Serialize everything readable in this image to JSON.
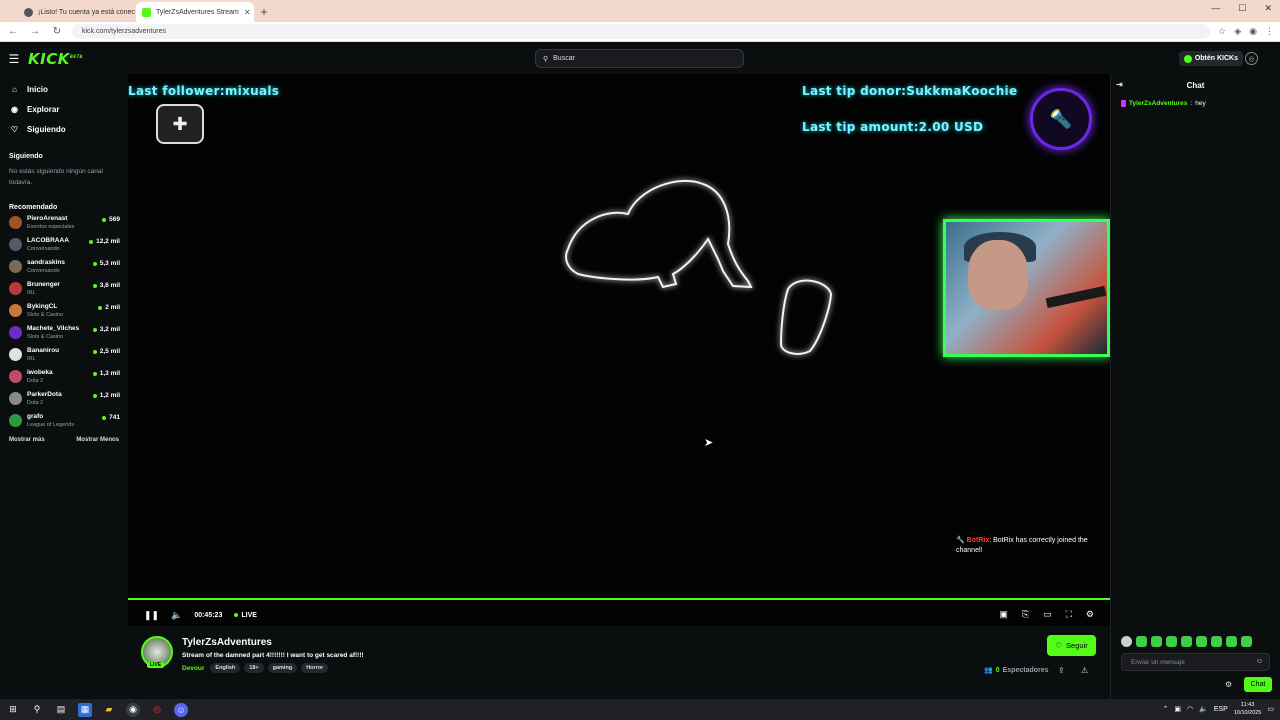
{
  "browser": {
    "tabs": [
      {
        "title": "¡Listo! Tu cuenta ya está conec",
        "icon": "search-icon"
      },
      {
        "title": "TylerZsAdventures Stream",
        "icon": "kick-icon"
      }
    ],
    "url": "kick.com/tylerzsadventures"
  },
  "topnav": {
    "logo": "KICK",
    "logo_badge": "BETA",
    "search_placeholder": "Buscar",
    "kicks_label": "Obtén KICKs"
  },
  "sidebar": {
    "links": [
      {
        "label": "Inicio",
        "icon": "home-icon"
      },
      {
        "label": "Explorar",
        "icon": "compass-icon"
      },
      {
        "label": "Siguiendo",
        "icon": "heart-icon"
      }
    ],
    "following_title": "Siguiendo",
    "following_empty": "No estás siguiendo ningún canal todavía.",
    "recommended_title": "Recomendado",
    "recommended": [
      {
        "name": "PieroArenast",
        "category": "Eventos especiales",
        "viewers": "569",
        "color": "#a0522d"
      },
      {
        "name": "LACOBRAAA",
        "category": "Conversando",
        "viewers": "12,2 mil",
        "color": "#555b66"
      },
      {
        "name": "sandraskins",
        "category": "Conversando",
        "viewers": "5,3 mil",
        "color": "#7a6a5a"
      },
      {
        "name": "Brunenger",
        "category": "IRL",
        "viewers": "3,6 mil",
        "color": "#b83b3b"
      },
      {
        "name": "BykingCL",
        "category": "Slots & Casino",
        "viewers": "2 mil",
        "color": "#c47a3a"
      },
      {
        "name": "Machete_Vilches",
        "category": "Slots & Casino",
        "viewers": "3,2 mil",
        "color": "#6a2fc2"
      },
      {
        "name": "Bananirou",
        "category": "IRL",
        "viewers": "2,5 mil",
        "color": "#e0e0e0"
      },
      {
        "name": "iwobeka",
        "category": "Dota 2",
        "viewers": "1,3 mil",
        "color": "#c4486a"
      },
      {
        "name": "ParkerDota",
        "category": "Dota 2",
        "viewers": "1,2 mil",
        "color": "#8a8a8a"
      },
      {
        "name": "grafo",
        "category": "League of Legends",
        "viewers": "741",
        "color": "#2e9b3a"
      }
    ],
    "show_more": "Mostrar más",
    "show_less": "Mostrar Menos"
  },
  "player": {
    "last_follower": "Last follower:mixuals",
    "last_tip_donor": "Last tip donor:SukkmaKoochie",
    "last_tip_amount": "Last tip amount:2.00 USD",
    "bot_name": "BotRix",
    "bot_message": ": BotRix has correctly joined the channel!",
    "elapsed": "00:45:23",
    "live_label": "LIVE",
    "progress": 1.0
  },
  "channel": {
    "name": "TylerZsAdventures",
    "live_badge": "LIVE",
    "stream_title": "Stream of the damned part 4!!!!!!! I want to get scared af!!!!",
    "category": "Devour",
    "tags": [
      "English",
      "18+",
      "gaming",
      "Horror"
    ],
    "follow_label": "Seguir",
    "viewers_count": "0",
    "viewers_label": "Espectadores"
  },
  "chat": {
    "title": "Chat",
    "messages": [
      {
        "user": "TylerZsAdventures",
        "text": "hey"
      }
    ],
    "input_placeholder": "Enviar un mensaje",
    "send_label": "Chat"
  },
  "taskbar": {
    "time": "11:43",
    "date": "10/10/2025",
    "lang": "ESP"
  }
}
